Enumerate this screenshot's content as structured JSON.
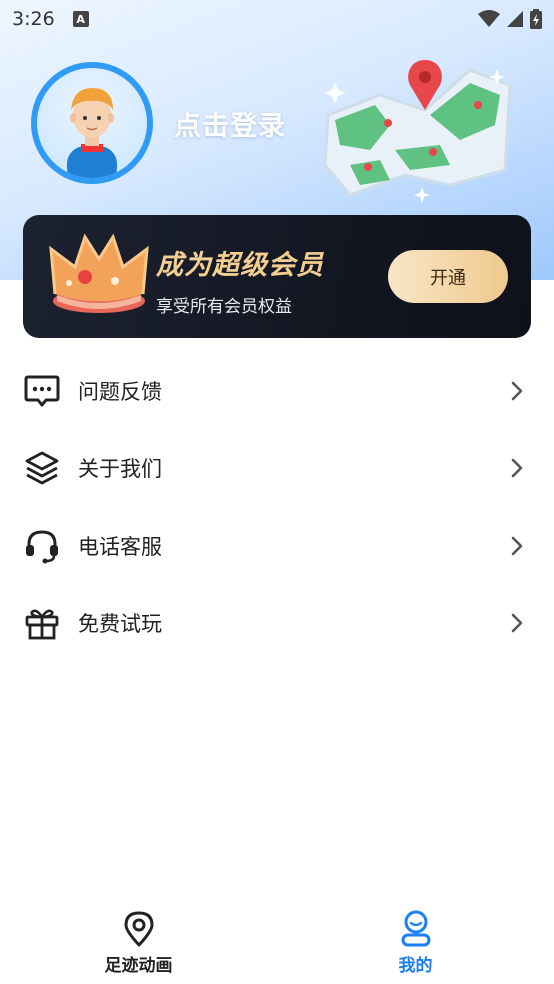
{
  "status_bar": {
    "time": "3:26",
    "indicator": "A"
  },
  "profile": {
    "login_text": "点击登录"
  },
  "vip": {
    "title": "成为超级会员",
    "subtitle": "享受所有会员权益",
    "button_label": "开通"
  },
  "menu": {
    "items": [
      {
        "label": "问题反馈",
        "icon": "message-dots-icon"
      },
      {
        "label": "关于我们",
        "icon": "layers-icon"
      },
      {
        "label": "电话客服",
        "icon": "headset-icon"
      },
      {
        "label": "免费试玩",
        "icon": "gift-icon"
      }
    ]
  },
  "nav": {
    "tabs": [
      {
        "label": "足迹动画",
        "icon": "map-pin-icon",
        "active": false
      },
      {
        "label": "我的",
        "icon": "user-icon",
        "active": true
      }
    ]
  },
  "colors": {
    "accent": "#1a7ef5",
    "vip_gold": "#f3cf92",
    "vip_card": "#131722"
  }
}
